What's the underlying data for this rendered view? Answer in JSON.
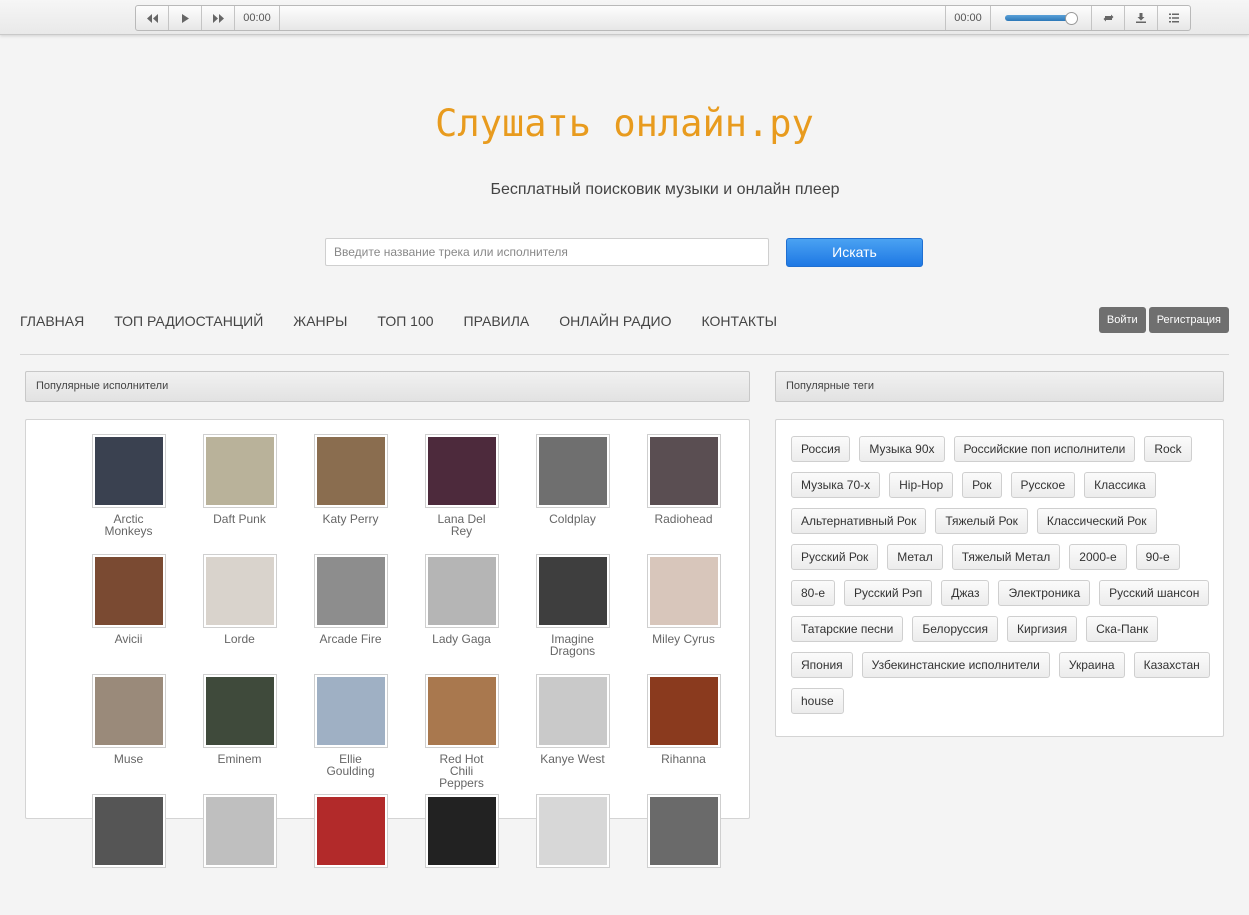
{
  "player": {
    "prev_icon": "prev-icon",
    "play_icon": "play-icon",
    "next_icon": "next-icon",
    "time_current": "00:00",
    "time_total": "00:00",
    "volume_level": 0.92,
    "repeat_icon": "repeat-icon",
    "download_icon": "download-icon",
    "playlist_icon": "playlist-icon"
  },
  "header": {
    "title": "Слушать онлайн.ру",
    "subtitle": "Бесплатный поисковик музыки и онлайн плеер"
  },
  "search": {
    "placeholder": "Введите название трека или исполнителя",
    "value": "",
    "button": "Искать"
  },
  "nav": {
    "items": [
      "ГЛАВНАЯ",
      "ТОП РАДИОСТАНЦИЙ",
      "ЖАНРЫ",
      "ТОП 100",
      "ПРАВИЛА",
      "ОНЛАЙН РАДИО",
      "КОНТАКТЫ"
    ],
    "login": "Войти",
    "register": "Регистрация"
  },
  "artists_panel": {
    "title": "Популярные исполнители",
    "artists": [
      {
        "name": "Arctic Monkeys",
        "color": "#3a4150"
      },
      {
        "name": "Daft Punk",
        "color": "#b9b29a"
      },
      {
        "name": "Katy Perry",
        "color": "#8a6d4f"
      },
      {
        "name": "Lana Del Rey",
        "color": "#4d2a3c"
      },
      {
        "name": "Coldplay",
        "color": "#6f6f6f"
      },
      {
        "name": "Radiohead",
        "color": "#5a4e52"
      },
      {
        "name": "Avicii",
        "color": "#7a4a32"
      },
      {
        "name": "Lorde",
        "color": "#d9d3cc"
      },
      {
        "name": "Arcade Fire",
        "color": "#8d8d8d"
      },
      {
        "name": "Lady Gaga",
        "color": "#b5b5b5"
      },
      {
        "name": "Imagine Dragons",
        "color": "#3e3e3e"
      },
      {
        "name": "Miley Cyrus",
        "color": "#d8c6bb"
      },
      {
        "name": "Muse",
        "color": "#9a8a7a"
      },
      {
        "name": "Eminem",
        "color": "#3f4a3b"
      },
      {
        "name": "Ellie Goulding",
        "color": "#9fb0c4"
      },
      {
        "name": "Red Hot Chili Peppers",
        "color": "#a9784e"
      },
      {
        "name": "Kanye West",
        "color": "#c9c9c9"
      },
      {
        "name": "Rihanna",
        "color": "#8a3a1e"
      },
      {
        "name": "",
        "color": "#555555"
      },
      {
        "name": "",
        "color": "#bfbfbf"
      },
      {
        "name": "",
        "color": "#b22a2a"
      },
      {
        "name": "",
        "color": "#222222"
      },
      {
        "name": "",
        "color": "#d7d7d7"
      },
      {
        "name": "",
        "color": "#6a6a6a"
      }
    ]
  },
  "tags_panel": {
    "title": "Популярные теги",
    "tags": [
      "Россия",
      "Музыка 90х",
      "Российские поп исполнители",
      "Rock",
      "Музыка 70-х",
      "Hip-Hop",
      "Рок",
      "Русское",
      "Классика",
      "Альтернативный Рок",
      "Тяжелый Рок",
      "Классический Рок",
      "Русский Рок",
      "Метал",
      "Тяжелый Метал",
      "2000-е",
      "90-е",
      "80-е",
      "Русский Рэп",
      "Джаз",
      "Электроника",
      "Русский шансон",
      "Татарские песни",
      "Белоруссия",
      "Киргизия",
      "Ска-Панк",
      "Япония",
      "Узбекинстанские исполнители",
      "Украина",
      "Казахстан",
      "house"
    ]
  }
}
